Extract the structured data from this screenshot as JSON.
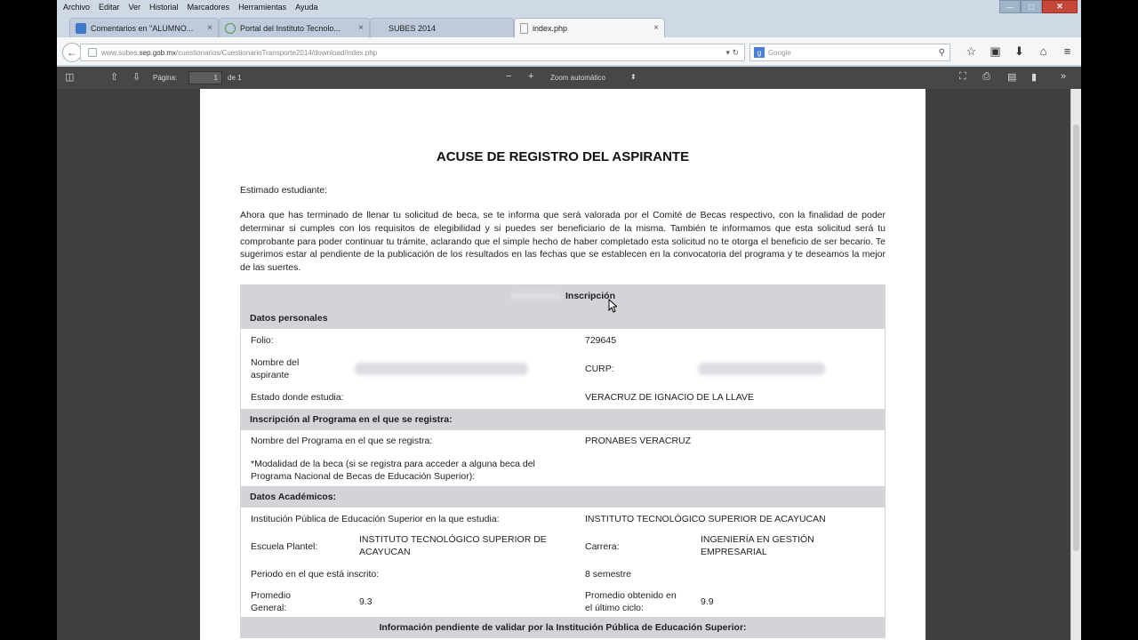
{
  "menubar": [
    "Archivo",
    "Editar",
    "Ver",
    "Historial",
    "Marcadores",
    "Herramientas",
    "Ayuda"
  ],
  "window_controls": {
    "minimize": "—",
    "maximize": "□",
    "close": "✕"
  },
  "tabs": [
    {
      "title": "Comentarios en \"ALUMNO...",
      "close": "×"
    },
    {
      "title": "Portal del Instituto Tecnolo...",
      "close": "×"
    },
    {
      "title": "SUBES 2014"
    },
    {
      "title": "index.php",
      "close": "×"
    }
  ],
  "newtab": "+",
  "nav": {
    "url_prefix": "www.subes.",
    "url_host": "sep.gob.mx",
    "url_path": "/cuestionarios/CuestionarioTransporte2014/download/index.php",
    "url_end": "▾ ↻",
    "search_engine": "g",
    "search_placeholder": "Google",
    "search_btn": "⚲",
    "icons": [
      "☆",
      "▣",
      "⬇",
      "⌂",
      "≡"
    ]
  },
  "pdf": {
    "page_label": "Página:",
    "page_value": "1",
    "of_label": "de 1",
    "zoom_label": "Zoom automático",
    "zoom_arrow": "⬍"
  },
  "document": {
    "title": "ACUSE DE REGISTRO DEL ASPIRANTE",
    "greeting": "Estimado estudiante:",
    "intro": "Ahora que has terminado de llenar tu solicitud de beca, se te informa que será valorada por el Comité de Becas respectivo, con la finalidad de poder determinar si cumples con los requisitos de elegibilidad y si puedes ser beneficiario de la misma. También te informamos que esta solicitud será tu comprobante para poder continuar tu trámite, aclarando que el simple hecho de haber completado esta solicitud no te otorga el beneficio de ser becario. Te sugerimos estar al pendiente de la publicación de los resultados en las fechas que se establecen en la convocatoria del programa y te deseamos la mejor de las suertes.",
    "table": {
      "header": "Inscripción",
      "sec_personal": "Datos personales",
      "folio_label": "Folio:",
      "folio_value": "729645",
      "nombre_label": "Nombre del aspirante",
      "curp_label": "CURP:",
      "estado_label": "Estado donde estudia:",
      "estado_value": "VERACRUZ DE IGNACIO DE LA LLAVE",
      "sec_programa": "Inscripción al Programa en el que se registra:",
      "programa_label": "Nombre del Programa en el que se registra:",
      "programa_value": "PRONABES VERACRUZ",
      "modalidad_label": "*Modalidad de la beca (si se registra para acceder a alguna beca del Programa Nacional de Becas de Educación Superior):",
      "sec_academicos": "Datos Académicos:",
      "institucion_label": "Institución Pública de Educación Superior en la que estudia:",
      "institucion_value": "INSTITUTO TECNOLÓGICO SUPERIOR DE ACAYUCAN",
      "escuela_label": "Escuela Plantel:",
      "escuela_value": "INSTITUTO TECNOLÓGICO SUPERIOR DE ACAYUCAN",
      "carrera_label": "Carrera:",
      "carrera_value": "INGENIERÍA EN GESTIÓN EMPRESARIAL",
      "periodo_label": "Periodo en el que está inscrito:",
      "periodo_value": "8 semestre",
      "promedio_label": "Promedio General:",
      "promedio_value": "9.3",
      "ultimo_label": "Promedio obtenido en el último ciclo:",
      "ultimo_value": "9.9",
      "sec_pendiente": "Información pendiente de validar por la Institución Pública de Educación Superior:"
    }
  }
}
